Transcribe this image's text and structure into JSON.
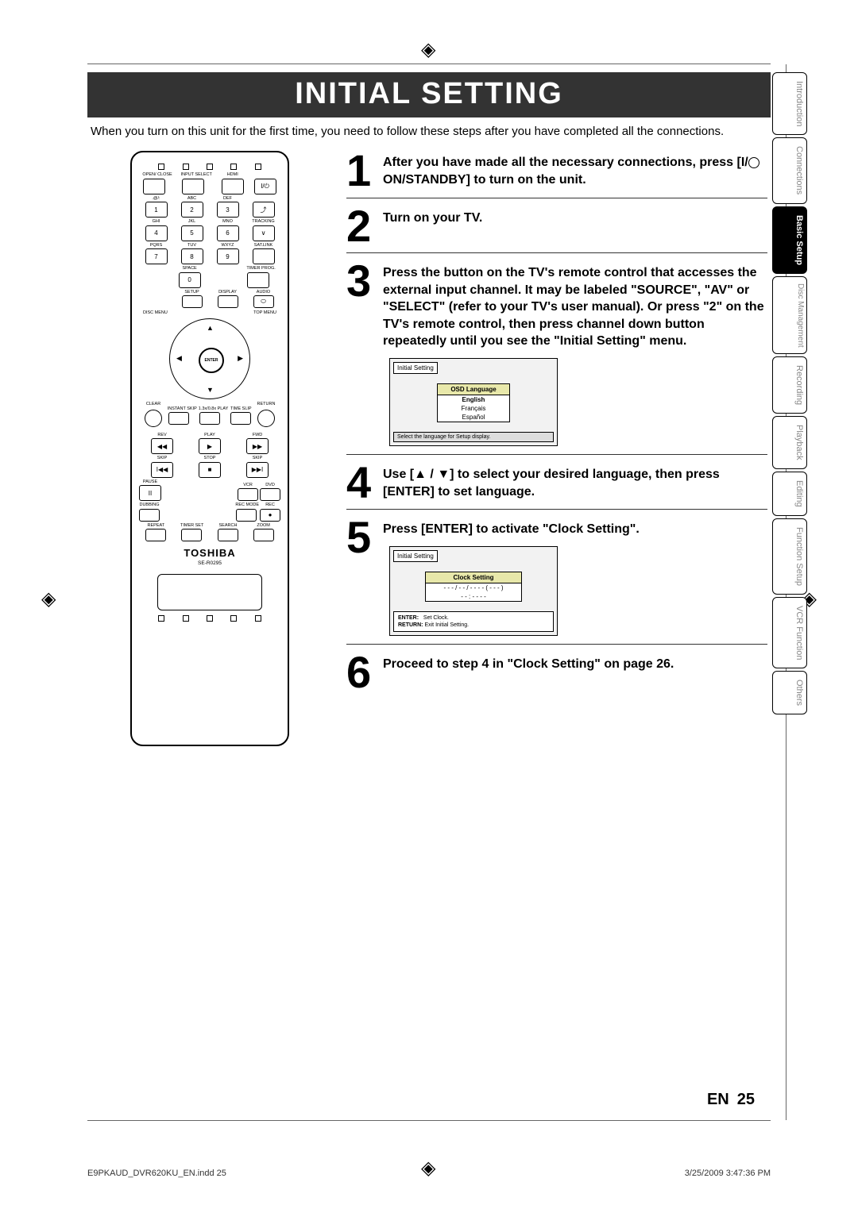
{
  "crop_glyph": "◈",
  "page": {
    "title": "INITIAL SETTING",
    "intro": "When you turn on this unit for the first time, you need to follow these steps after you have completed all the connections.",
    "lang_code": "EN",
    "page_number": "25"
  },
  "footer": {
    "file": "E9PKAUD_DVR620KU_EN.indd   25",
    "timestamp": "3/25/2009   3:47:36 PM"
  },
  "side_tabs": [
    {
      "label": "Introduction",
      "active": false
    },
    {
      "label": "Connections",
      "active": false
    },
    {
      "label": "Basic Setup",
      "active": true
    },
    {
      "label": "Disc Management",
      "active": false,
      "double": true
    },
    {
      "label": "Recording",
      "active": false
    },
    {
      "label": "Playback",
      "active": false
    },
    {
      "label": "Editing",
      "active": false
    },
    {
      "label": "Function Setup",
      "active": false
    },
    {
      "label": "VCR Function",
      "active": false
    },
    {
      "label": "Others",
      "active": false
    }
  ],
  "steps": [
    {
      "num": "1",
      "text_parts": [
        "After you have made all the necessary connections, press [I/",
        " ON/STANDBY] to turn on the unit."
      ],
      "has_power_icon": true
    },
    {
      "num": "2",
      "text": "Turn on your TV."
    },
    {
      "num": "3",
      "text": "Press the button on the TV's remote control that accesses the external input channel. It may be labeled \"SOURCE\", \"AV\" or \"SELECT\" (refer to your TV's user manual). Or press \"2\" on the TV's remote control, then press channel down button repeatedly until you see the \"Initial Setting\" menu.",
      "osd": {
        "title": "Initial Setting",
        "menu_header": "OSD Language",
        "options": [
          "English",
          "Français",
          "Español"
        ],
        "footer": "Select the language for Setup display."
      }
    },
    {
      "num": "4",
      "text_pre": "Use [",
      "text_post": "] to select your desired language, then press [ENTER] to set language.",
      "has_arrows": true
    },
    {
      "num": "5",
      "text": "Press [ENTER] to activate \"Clock Setting\".",
      "osd": {
        "title": "Initial Setting",
        "menu_header": "Clock Setting",
        "date_placeholder": "- - -  /  - -  /  - - - -  ( - - - )",
        "time_placeholder": "- -  :  - -  - -",
        "footer_lines": [
          "ENTER:    Set Clock.",
          "RETURN:  Exit Initial Setting."
        ]
      }
    },
    {
      "num": "6",
      "text": "Proceed to step 4 in \"Clock Setting\" on page 26."
    }
  ],
  "remote": {
    "brand": "TOSHIBA",
    "model": "SE-R0295",
    "row1": [
      "OPEN/ CLOSE",
      "INPUT SELECT",
      "HDMI",
      ""
    ],
    "row2_lbl": [
      ".@/:",
      "ABC",
      "DEF",
      ""
    ],
    "row2": [
      "1",
      "2",
      "3",
      "⏻"
    ],
    "row3_lbl": [
      "GHI",
      "JKL",
      "MNO",
      "TRACKING"
    ],
    "row3": [
      "4",
      "5",
      "6",
      "∨"
    ],
    "row4_lbl": [
      "PQRS",
      "TUV",
      "WXYZ",
      "SAT.LINK"
    ],
    "row4": [
      "7",
      "8",
      "9",
      ""
    ],
    "row5_lbl": [
      "",
      "SPACE",
      "",
      "TIMER PROG."
    ],
    "row5": [
      "",
      "0",
      "",
      ""
    ],
    "row6_lbl": [
      "",
      "SETUP",
      "DISPLAY",
      "AUDIO"
    ],
    "menu_left": "DISC MENU",
    "menu_right": "TOP MENU",
    "enter": "ENTER",
    "clear": "CLEAR",
    "return": "RETURN",
    "mid_lbls": [
      "INSTANT SKIP",
      "1.3x/0.8x PLAY",
      "TIME SLIP"
    ],
    "trans_lbls": [
      "REV",
      "PLAY",
      "FWD"
    ],
    "trans_lbls2": [
      "SKIP",
      "STOP",
      "SKIP"
    ],
    "pause": "PAUSE",
    "vcr": "VCR",
    "dvd": "DVD",
    "dubbing": "DUBBING",
    "recmode": "REC MODE",
    "rec": "REC",
    "bottom_lbls": [
      "REPEAT",
      "TIMER SET",
      "SEARCH",
      "ZOOM"
    ]
  }
}
